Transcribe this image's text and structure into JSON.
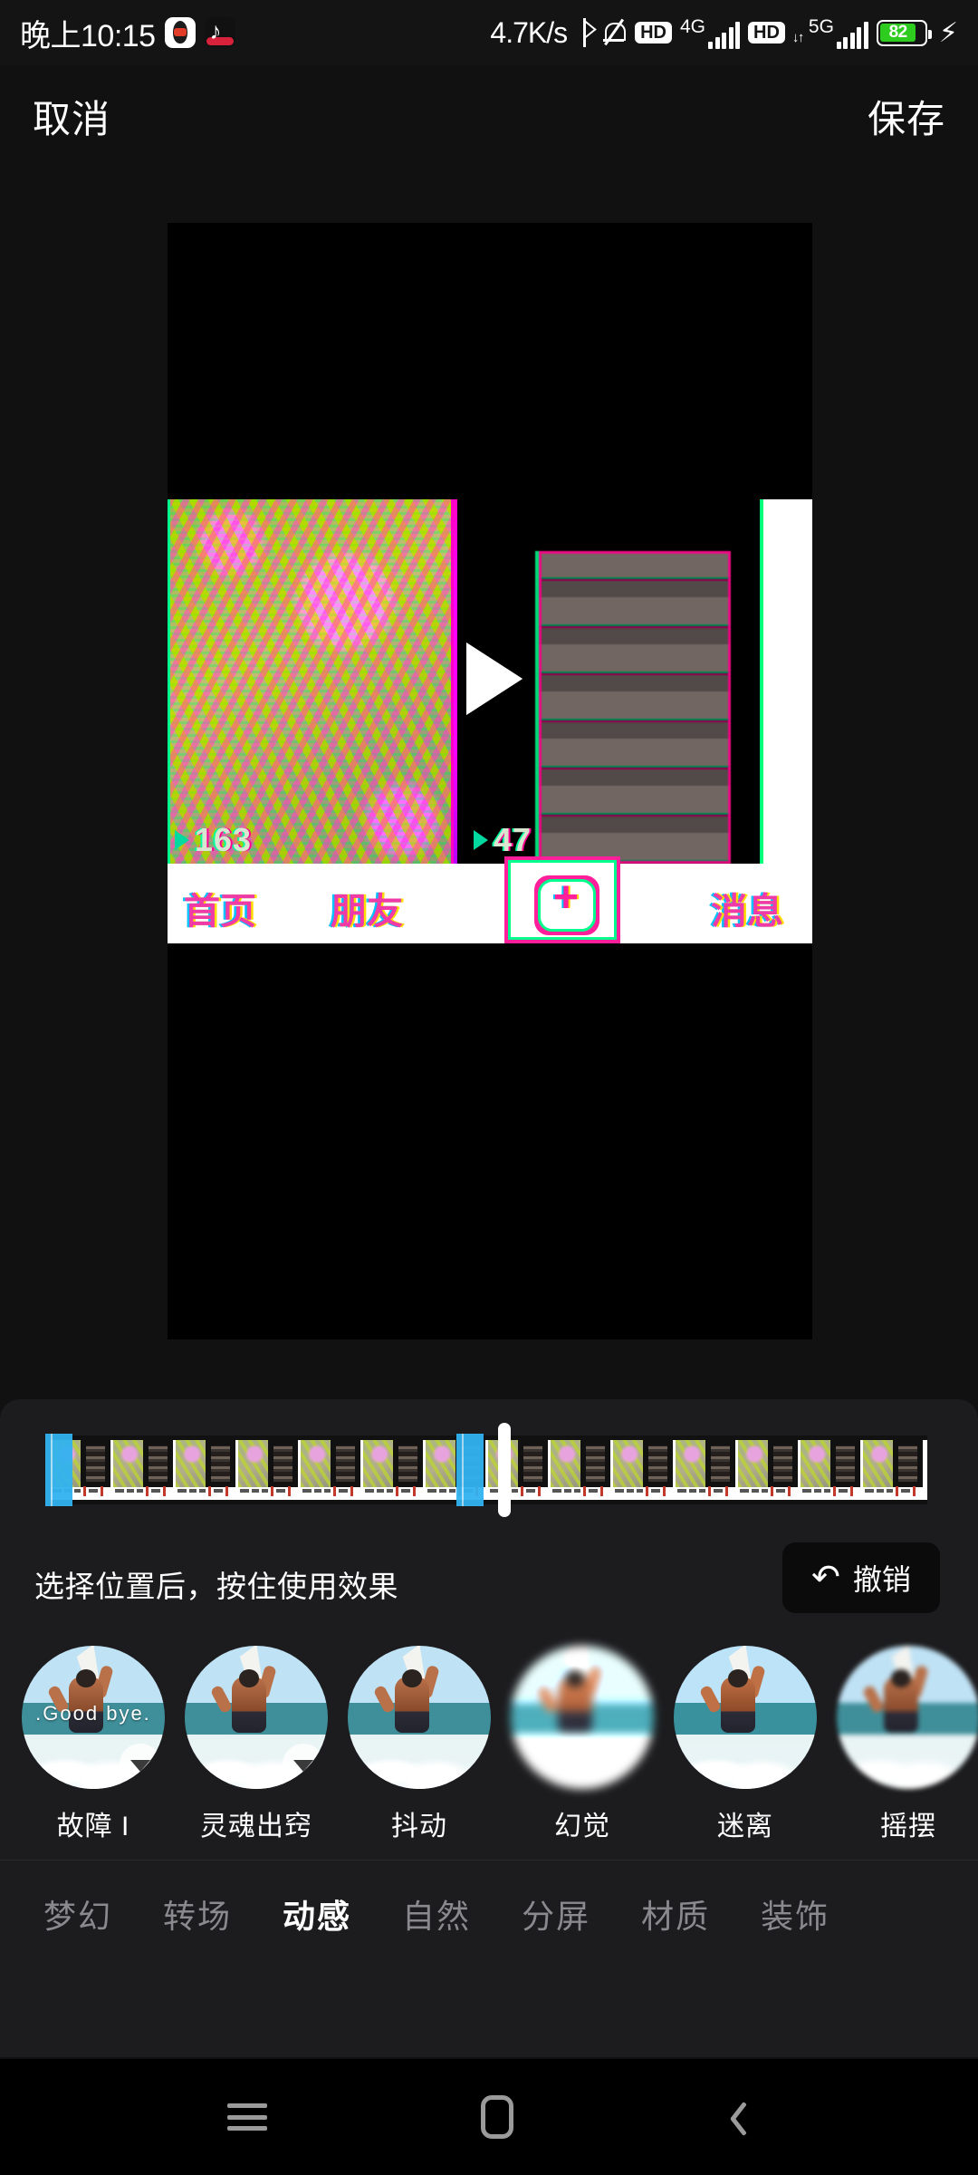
{
  "status_bar": {
    "clock": "晚上10:15",
    "net_speed": "4.7K/s",
    "app_icons": [
      "qq-icon",
      "douyin-icon"
    ],
    "icons": [
      "bluetooth-icon",
      "mute-bell-icon",
      "hd-icon",
      "signal-4g-icon",
      "hd-icon",
      "signal-5g-icon",
      "battery-icon"
    ],
    "volte_label_1": "HD",
    "network_label_1": "4G",
    "volte_label_2": "HD",
    "network_label_2": "5G",
    "battery_level": "82",
    "charging": "⚡",
    "battery_color": "#2ecc1f"
  },
  "top_bar": {
    "cancel_label": "取消",
    "save_label": "保存"
  },
  "preview": {
    "play_overlay": "play-icon",
    "overlay_counts": [
      "163",
      "47"
    ],
    "inner_nav": [
      "首页",
      "朋友",
      "消息"
    ],
    "inner_plus": "+"
  },
  "timeline": {
    "frame_count": 14,
    "markers": [
      0,
      9
    ],
    "playhead_position_pct": 51,
    "marker_color": "#32b3f0",
    "playhead_color": "#ffffff"
  },
  "hint": {
    "text": "选择位置后，按住使用效果",
    "undo_icon": "undo-arrow-icon",
    "undo_label": "撤销"
  },
  "effects": [
    {
      "label": "故障 I",
      "overlay_text": ".Good  bye.",
      "downloadable": true
    },
    {
      "label": "灵魂出窍",
      "overlay_text": "",
      "downloadable": true
    },
    {
      "label": "抖动",
      "overlay_text": "",
      "downloadable": false
    },
    {
      "label": "幻觉",
      "overlay_text": "",
      "downloadable": false
    },
    {
      "label": "迷离",
      "overlay_text": "",
      "downloadable": false
    },
    {
      "label": "摇摆",
      "overlay_text": "",
      "downloadable": false
    }
  ],
  "categories": [
    {
      "label": "梦幻",
      "active": false
    },
    {
      "label": "转场",
      "active": false
    },
    {
      "label": "动感",
      "active": true
    },
    {
      "label": "自然",
      "active": false
    },
    {
      "label": "分屏",
      "active": false
    },
    {
      "label": "材质",
      "active": false
    },
    {
      "label": "装饰",
      "active": false
    }
  ],
  "system_nav": {
    "recents": "recents-icon",
    "home": "home-icon",
    "back": "back-icon"
  }
}
